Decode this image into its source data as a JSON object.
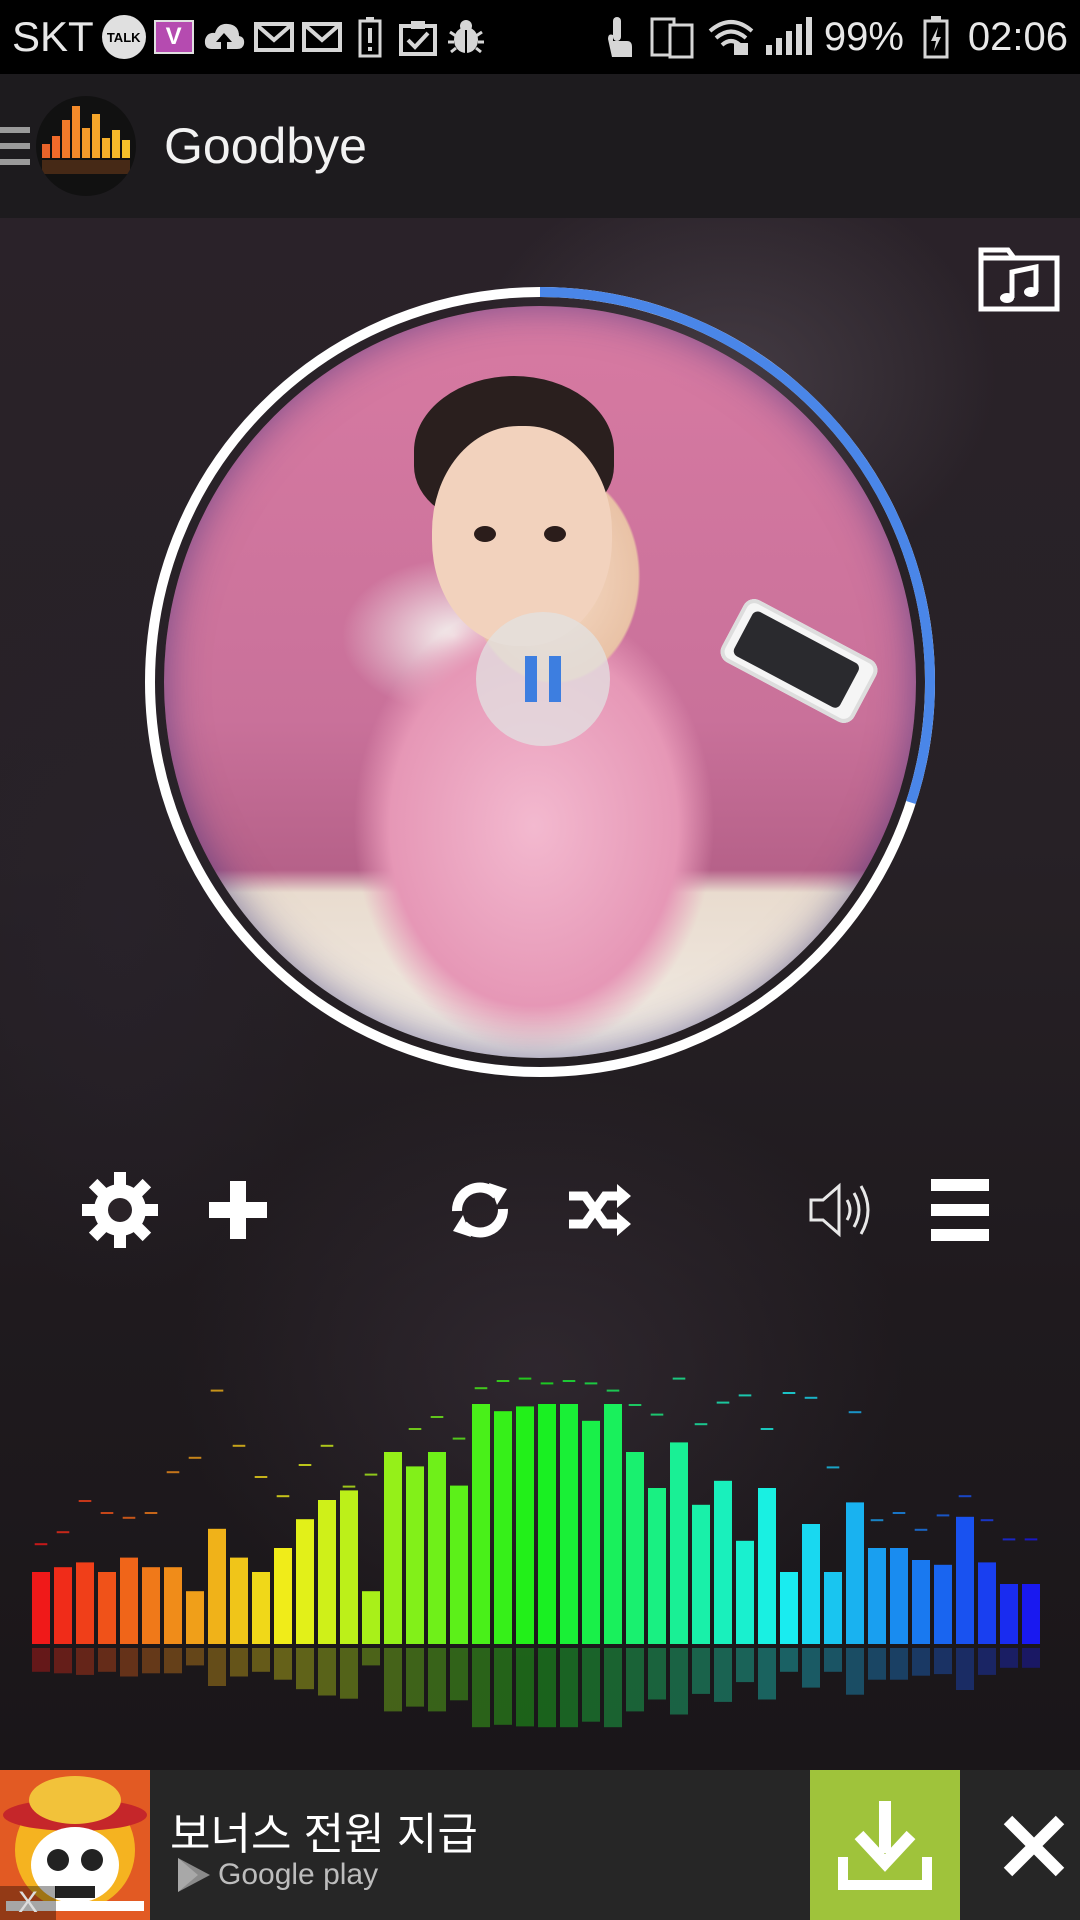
{
  "status_bar": {
    "carrier": "SKT",
    "talk_badge": "TALK",
    "v_badge": "V",
    "battery_percent": "99%",
    "time": "02:06"
  },
  "app_bar": {
    "track_title": "Goodbye"
  },
  "player": {
    "progress_fraction": 0.3,
    "state": "playing",
    "accent_color": "#4a86e8"
  },
  "controls": {
    "settings_icon": "gear-icon",
    "add_icon": "plus-icon",
    "repeat_icon": "repeat-icon",
    "shuffle_icon": "shuffle-icon",
    "volume_icon": "volume-icon",
    "playlist_icon": "playlist-icon"
  },
  "visualizer": {
    "levels": [
      0.3,
      0.32,
      0.34,
      0.3,
      0.36,
      0.32,
      0.32,
      0.22,
      0.48,
      0.36,
      0.3,
      0.4,
      0.52,
      0.6,
      0.64,
      0.22,
      0.8,
      0.74,
      0.8,
      0.66,
      1.0,
      0.97,
      0.99,
      1.0,
      1.0,
      0.93,
      1.0,
      0.8,
      0.65,
      0.84,
      0.58,
      0.68,
      0.43,
      0.65,
      0.3,
      0.5,
      0.3,
      0.59,
      0.4,
      0.4,
      0.35,
      0.33,
      0.53,
      0.34,
      0.25,
      0.25
    ],
    "peaks": [
      0.42,
      0.47,
      0.6,
      0.55,
      0.53,
      0.55,
      0.72,
      0.78,
      1.06,
      0.83,
      0.7,
      0.62,
      0.75,
      0.83,
      0.66,
      0.71,
      0.8,
      0.9,
      0.95,
      0.86,
      1.07,
      1.1,
      1.11,
      1.09,
      1.1,
      1.09,
      1.06,
      1.0,
      0.96,
      1.11,
      0.92,
      1.01,
      1.04,
      0.9,
      1.05,
      1.03,
      0.74,
      0.97,
      0.52,
      0.55,
      0.48,
      0.54,
      0.62,
      0.52,
      0.44,
      0.44
    ]
  },
  "ad_banner": {
    "headline": "보너스 전원 지급",
    "store_label": "Google play",
    "download_icon": "download-icon",
    "close_icon": "close-icon",
    "small_close": "X",
    "brand_color": "#9fc33b"
  }
}
